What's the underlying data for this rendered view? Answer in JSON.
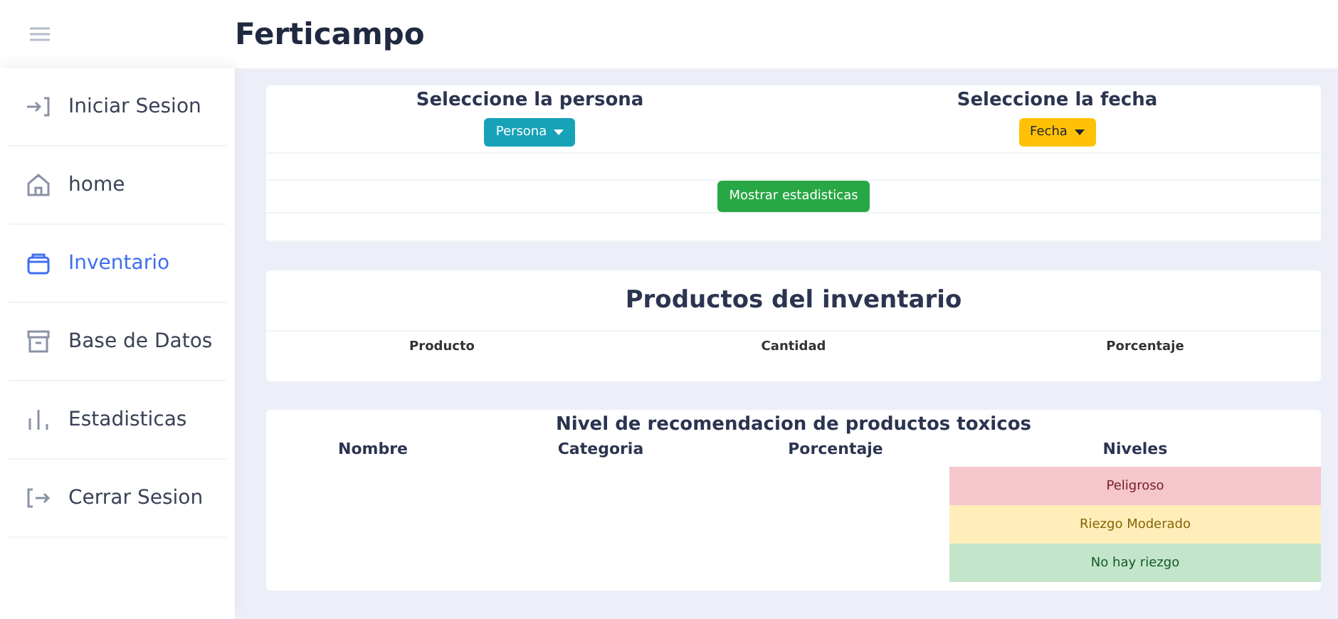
{
  "header": {
    "title": "Ferticampo"
  },
  "sidebar": {
    "items": [
      {
        "label": "Iniciar Sesion",
        "kind": "login",
        "selected": false
      },
      {
        "label": "home",
        "kind": "home",
        "selected": false
      },
      {
        "label": "Inventario",
        "kind": "bag",
        "selected": true
      },
      {
        "label": "Base de Datos",
        "kind": "archive",
        "selected": false
      },
      {
        "label": "Estadisticas",
        "kind": "bars",
        "selected": false
      },
      {
        "label": "Cerrar Sesion",
        "kind": "logout",
        "selected": false
      }
    ]
  },
  "filters": [
    {
      "heading": "Seleccione la persona",
      "button": "Persona",
      "kind": "info"
    },
    {
      "heading": "Seleccione la fecha",
      "button": "Fecha",
      "kind": "warning"
    }
  ],
  "show_button": "Mostrar estadisticas",
  "inventory": {
    "title": "Productos del inventario",
    "columns": [
      "Producto",
      "Cantidad",
      "Porcentaje"
    ]
  },
  "toxic": {
    "title": "Nivel de recomendacion de productos toxicos",
    "columns": [
      "Nombre",
      "Categoria",
      "Porcentaje",
      "Niveles"
    ],
    "levels": [
      {
        "label": "Peligroso",
        "color": "#f5c6cb"
      },
      {
        "label": "Riezgo Moderado",
        "color": "#ffeeba"
      },
      {
        "label": "No hay riezgo",
        "color": "#c3e6cb"
      }
    ]
  }
}
